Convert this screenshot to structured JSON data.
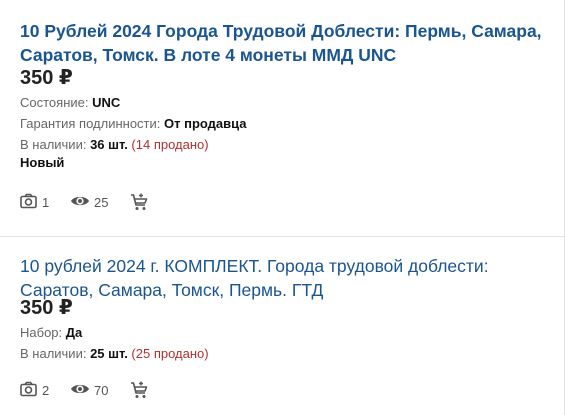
{
  "listings": [
    {
      "title": "10 Рублей 2024 Города Трудовой Доблести: Пермь, Самара, Саратов, Томск. В лоте 4 монеты ММД UNC",
      "price": "350 ₽",
      "details": [
        {
          "label": "Состояние: ",
          "value": "UNC"
        },
        {
          "label": "Гарантия подлинности: ",
          "value": "От продавца"
        }
      ],
      "availability": {
        "label": "В наличии: ",
        "value": "36 шт.",
        "sold": " (14 продано)"
      },
      "badge": "Новый",
      "photos": "1",
      "views": "25",
      "cart_icon": "cart-add-icon"
    },
    {
      "title": "10 рублей 2024 г. КОМПЛЕКТ. Города трудовой доблести: Саратов, Самара, Томск, Пермь. ГТД",
      "price": "350 ₽",
      "details": [
        {
          "label": "Набор: ",
          "value": "Да"
        }
      ],
      "availability": {
        "label": "В наличии: ",
        "value": "25 шт.",
        "sold": " (25 продано)"
      },
      "photos": "2",
      "views": "70",
      "cart_icon": "cart-add-icon"
    }
  ],
  "colors": {
    "title_link": "#1a5590",
    "sold_text": "#b03030",
    "label_text": "#666666",
    "icon": "#555555"
  }
}
